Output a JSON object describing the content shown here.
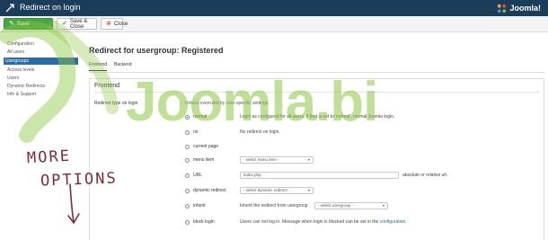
{
  "app": {
    "title": "Redirect on login",
    "brand": "Joomla!"
  },
  "toolbar": {
    "save_label": "Save",
    "save_close_label": "Save & Close",
    "close_label": "Close"
  },
  "sidebar": {
    "items": [
      {
        "label": "Configuration",
        "active": false
      },
      {
        "label": "All users",
        "active": false
      },
      {
        "label": "Usergroups",
        "active": true
      },
      {
        "label": "Access levels",
        "active": false
      },
      {
        "label": "Users",
        "active": false
      },
      {
        "label": "Dynamic Redirects",
        "active": false
      },
      {
        "label": "Info & Support",
        "active": false
      }
    ]
  },
  "main": {
    "page_title": "Redirect for usergroup: Registered",
    "tabs": [
      {
        "label": "Frontend",
        "active": true
      },
      {
        "label": "Backend",
        "active": false
      }
    ],
    "panel_legend": "Frontend",
    "field_label": "Redirect type on login",
    "field_desc": "Unless overruled by user-specific settings.",
    "options": [
      {
        "label": "normal",
        "checked": true,
        "desc": "Login as configured for all users. If that is set to 'normal', normal Joomla login."
      },
      {
        "label": "no",
        "checked": false,
        "desc": "No redirect on login."
      },
      {
        "label": "current page",
        "checked": false
      },
      {
        "label": "menu item",
        "checked": false,
        "select": "- select menu item -"
      },
      {
        "label": "URL",
        "checked": false,
        "input_value": "index.php",
        "input_note": "absolute or relative url."
      },
      {
        "label": "dynamic redirect",
        "checked": false,
        "select": "- select dynamic redirect -"
      },
      {
        "label": "inherit",
        "checked": false,
        "desc": "Inherit the redirect from usergroup",
        "select": "- select usergroup -"
      },
      {
        "label": "block login",
        "checked": false,
        "desc": "Users can not log in. Message when login is blocked can be set in the",
        "desc_link": "configuration",
        "desc_end": "."
      }
    ]
  },
  "overlay": {
    "watermark": "Joomla.bi",
    "handwritten_line1": "MORE",
    "handwritten_line2": "OPTIONS"
  },
  "colors": {
    "header": "#1c3d5a",
    "save_button": "#46a546",
    "active_sidebar": "#2d6ca2",
    "watermark": "#8bc740",
    "handwriting": "#7b2d3d"
  }
}
